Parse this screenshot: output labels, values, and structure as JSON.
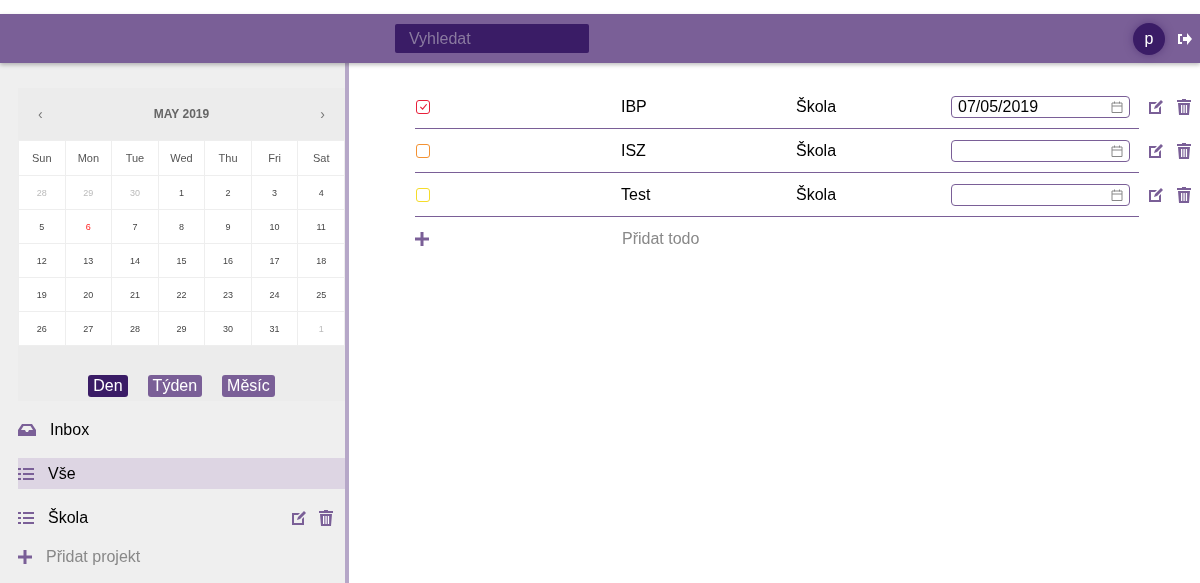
{
  "header": {
    "search": {
      "placeholder": "Vyhledat"
    },
    "avatar": "p"
  },
  "calendar": {
    "prev": "‹",
    "title": "MAY 2019",
    "next": "›",
    "weekdays": [
      "Sun",
      "Mon",
      "Tue",
      "Wed",
      "Thu",
      "Fri",
      "Sat"
    ],
    "weeks": [
      [
        {
          "day": "28",
          "kind": "outside"
        },
        {
          "day": "29",
          "kind": "outside"
        },
        {
          "day": "30",
          "kind": "outside"
        },
        {
          "day": "1",
          "kind": "day"
        },
        {
          "day": "2",
          "kind": "day"
        },
        {
          "day": "3",
          "kind": "day"
        },
        {
          "day": "4",
          "kind": "day"
        }
      ],
      [
        {
          "day": "5",
          "kind": "day"
        },
        {
          "day": "6",
          "kind": "today"
        },
        {
          "day": "7",
          "kind": "day"
        },
        {
          "day": "8",
          "kind": "day"
        },
        {
          "day": "9",
          "kind": "day"
        },
        {
          "day": "10",
          "kind": "day"
        },
        {
          "day": "11",
          "kind": "day"
        }
      ],
      [
        {
          "day": "12",
          "kind": "day"
        },
        {
          "day": "13",
          "kind": "day"
        },
        {
          "day": "14",
          "kind": "day"
        },
        {
          "day": "15",
          "kind": "day"
        },
        {
          "day": "16",
          "kind": "day"
        },
        {
          "day": "17",
          "kind": "day"
        },
        {
          "day": "18",
          "kind": "day"
        }
      ],
      [
        {
          "day": "19",
          "kind": "day"
        },
        {
          "day": "20",
          "kind": "day"
        },
        {
          "day": "21",
          "kind": "day"
        },
        {
          "day": "22",
          "kind": "day"
        },
        {
          "day": "23",
          "kind": "day"
        },
        {
          "day": "24",
          "kind": "day"
        },
        {
          "day": "25",
          "kind": "day"
        }
      ],
      [
        {
          "day": "26",
          "kind": "day"
        },
        {
          "day": "27",
          "kind": "day"
        },
        {
          "day": "28",
          "kind": "day"
        },
        {
          "day": "29",
          "kind": "day"
        },
        {
          "day": "30",
          "kind": "day"
        },
        {
          "day": "31",
          "kind": "day"
        },
        {
          "day": "1",
          "kind": "outside"
        }
      ]
    ],
    "views": [
      {
        "label": "Den",
        "selected": true
      },
      {
        "label": "Týden",
        "selected": false
      },
      {
        "label": "Měsíc",
        "selected": false
      }
    ]
  },
  "nav": [
    {
      "label": "Inbox",
      "kind": "inbox",
      "selected": false,
      "editable": false
    },
    {
      "label": "Vše",
      "kind": "list",
      "selected": true,
      "editable": false
    },
    {
      "label": "Škola",
      "kind": "list",
      "selected": false,
      "editable": true
    }
  ],
  "add_project": "Přidat projekt",
  "todos": [
    {
      "name": "IBP",
      "project": "Škola",
      "date": "07/05/2019",
      "checked": true,
      "color": "#e8203a"
    },
    {
      "name": "ISZ",
      "project": "Škola",
      "checked": false,
      "color": "#f39233"
    },
    {
      "name": "Test",
      "project": "Škola",
      "checked": false,
      "color": "#f5dc2a"
    }
  ],
  "add_todo": "Přidat todo"
}
